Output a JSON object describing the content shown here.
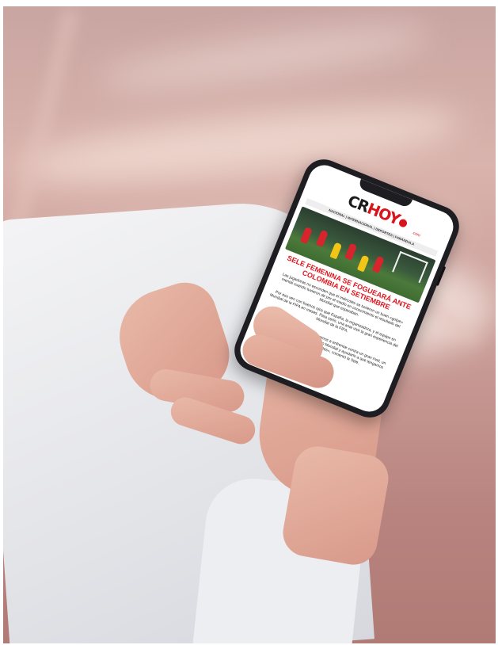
{
  "scene": {
    "description_free": true
  },
  "phone": {
    "logo_part1": "CR",
    "logo_part2": "HOY",
    "logo_suffix": ".com",
    "nav": "NACIONAL | INTERNACIONAL | DEPORTES | FARÁNDULA",
    "headline": "SELE FEMENINA SE FOGUEARÁ ANTE COLOMBIA EN SETIEMBRE",
    "paragraph1": "Las jugadoras no esconden que el miércoles se tuvieron un buen «golpe» mental cuando tuvieron de por el medio en conocimiento el resultado del Mundial que esperaban.",
    "paragraph2": "Por eso ven con buenos ojos que España, la organizadora, y el equipo en Mundial de la FIFA en meses. Para serlo, una ante vivir la gran experiencia del Mundial de la FIFA.",
    "paragraph3": "«Para nadie es un secreto que vamos a enfrentar contra un gran rival, un equipo que nos llevamos al próximo Mundial y ayudarlo a que tengamos mentalidad, convenientes», comentó la Sele."
  },
  "colors": {
    "brand_red": "#d9141c",
    "brand_dark": "#1b1b1b"
  }
}
